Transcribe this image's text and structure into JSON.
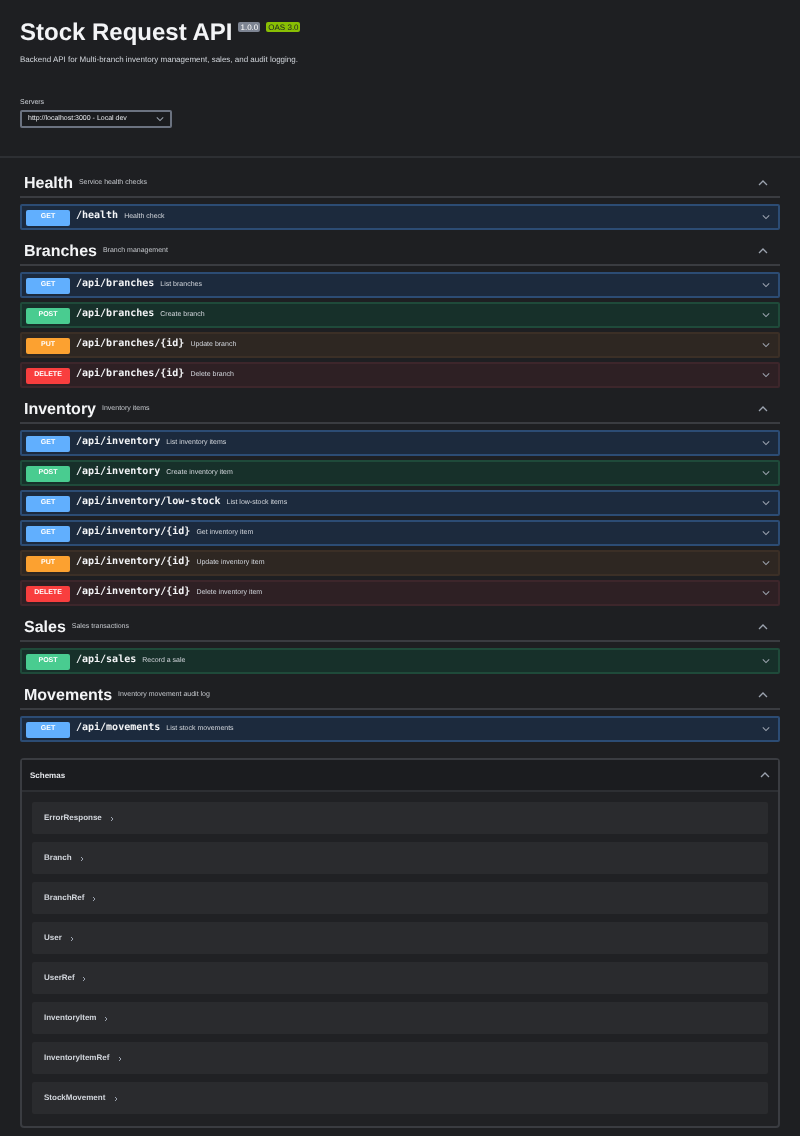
{
  "title": "Stock Request API",
  "version": "1.0.0",
  "oas": "OAS 3.0",
  "description": "Backend API for Multi-branch inventory management, sales, and audit logging.",
  "servers": {
    "label": "Servers",
    "value": "http://localhost:3000 - Local dev"
  },
  "sections": [
    {
      "name": "Health",
      "description": "Service health checks",
      "expanded": true,
      "operations": [
        {
          "method": "GET",
          "path": "/health",
          "summary": "Health check"
        }
      ]
    },
    {
      "name": "Branches",
      "description": "Branch management",
      "expanded": true,
      "operations": [
        {
          "method": "GET",
          "path": "/api/branches",
          "summary": "List branches"
        },
        {
          "method": "POST",
          "path": "/api/branches",
          "summary": "Create branch"
        },
        {
          "method": "PUT",
          "path": "/api/branches/{id}",
          "summary": "Update branch"
        },
        {
          "method": "DELETE",
          "path": "/api/branches/{id}",
          "summary": "Delete branch"
        }
      ]
    },
    {
      "name": "Inventory",
      "description": "Inventory items",
      "expanded": true,
      "operations": [
        {
          "method": "GET",
          "path": "/api/inventory",
          "summary": "List inventory items"
        },
        {
          "method": "POST",
          "path": "/api/inventory",
          "summary": "Create inventory item"
        },
        {
          "method": "GET",
          "path": "/api/inventory/low-stock",
          "summary": "List low-stock items"
        },
        {
          "method": "GET",
          "path": "/api/inventory/{id}",
          "summary": "Get inventory item"
        },
        {
          "method": "PUT",
          "path": "/api/inventory/{id}",
          "summary": "Update inventory item"
        },
        {
          "method": "DELETE",
          "path": "/api/inventory/{id}",
          "summary": "Delete inventory item"
        }
      ]
    },
    {
      "name": "Sales",
      "description": "Sales transactions",
      "expanded": true,
      "operations": [
        {
          "method": "POST",
          "path": "/api/sales",
          "summary": "Record a sale"
        }
      ]
    },
    {
      "name": "Movements",
      "description": "Inventory movement audit log",
      "expanded": true,
      "operations": [
        {
          "method": "GET",
          "path": "/api/movements",
          "summary": "List stock movements"
        }
      ]
    }
  ],
  "schemas": {
    "title": "Schemas",
    "expanded": true,
    "items": [
      {
        "name": "ErrorResponse"
      },
      {
        "name": "Branch"
      },
      {
        "name": "BranchRef"
      },
      {
        "name": "User"
      },
      {
        "name": "UserRef"
      },
      {
        "name": "InventoryItem"
      },
      {
        "name": "InventoryItemRef"
      },
      {
        "name": "StockMovement"
      }
    ]
  }
}
